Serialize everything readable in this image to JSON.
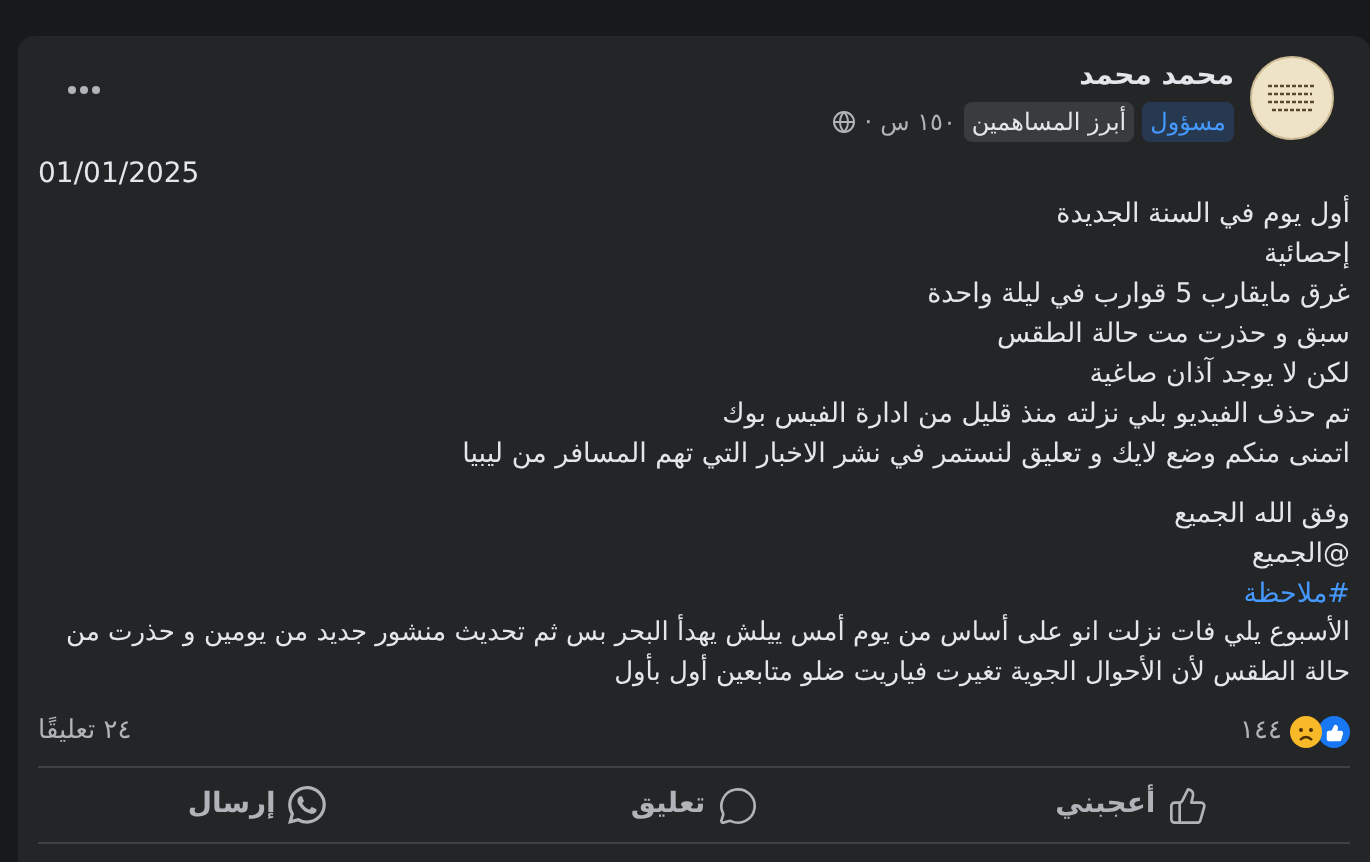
{
  "post": {
    "author": "محمد محمد",
    "badges": [
      {
        "label": "مسؤول",
        "kind": "admin"
      },
      {
        "label": "أبرز المساهمين",
        "kind": "contributor"
      }
    ],
    "time": "١٥٠ س",
    "separator": "·",
    "date": "01/01/2025",
    "lines": [
      "أول يوم في السنة الجديدة",
      "إحصائية",
      "غرق مايقارب 5 قوارب في ليلة واحدة",
      "سبق و حذرت مت حالة الطقس",
      "لكن لا يوجد آذان صاغية",
      "تم حذف الفيديو بلي نزلته منذ قليل من ادارة الفيس بوك",
      "اتمنى منكم وضع لايك و تعليق لنستمر في نشر الاخبار التي تهم المسافر من ليبيا"
    ],
    "closing": [
      "وفق الله الجميع",
      "@الجميع"
    ],
    "hashtag": "#ملاحظة",
    "paragraph": "الأسبوع يلي فات نزلت انو على أساس من يوم أمس ييلش يهدأ البحر بس ثم تحديث منشور جديد من يومين و حذرت من حالة الطقس لأن الأحوال الجوية تغيرت فياريت ضلو متابعين أول بأول",
    "reaction_count": "١٤٤",
    "comments": "٢٤ تعليقًا",
    "actions": [
      {
        "label": "أعجبني",
        "kind": "like"
      },
      {
        "label": "تعليق",
        "kind": "comment"
      },
      {
        "label": "إرسال",
        "kind": "send"
      }
    ]
  }
}
